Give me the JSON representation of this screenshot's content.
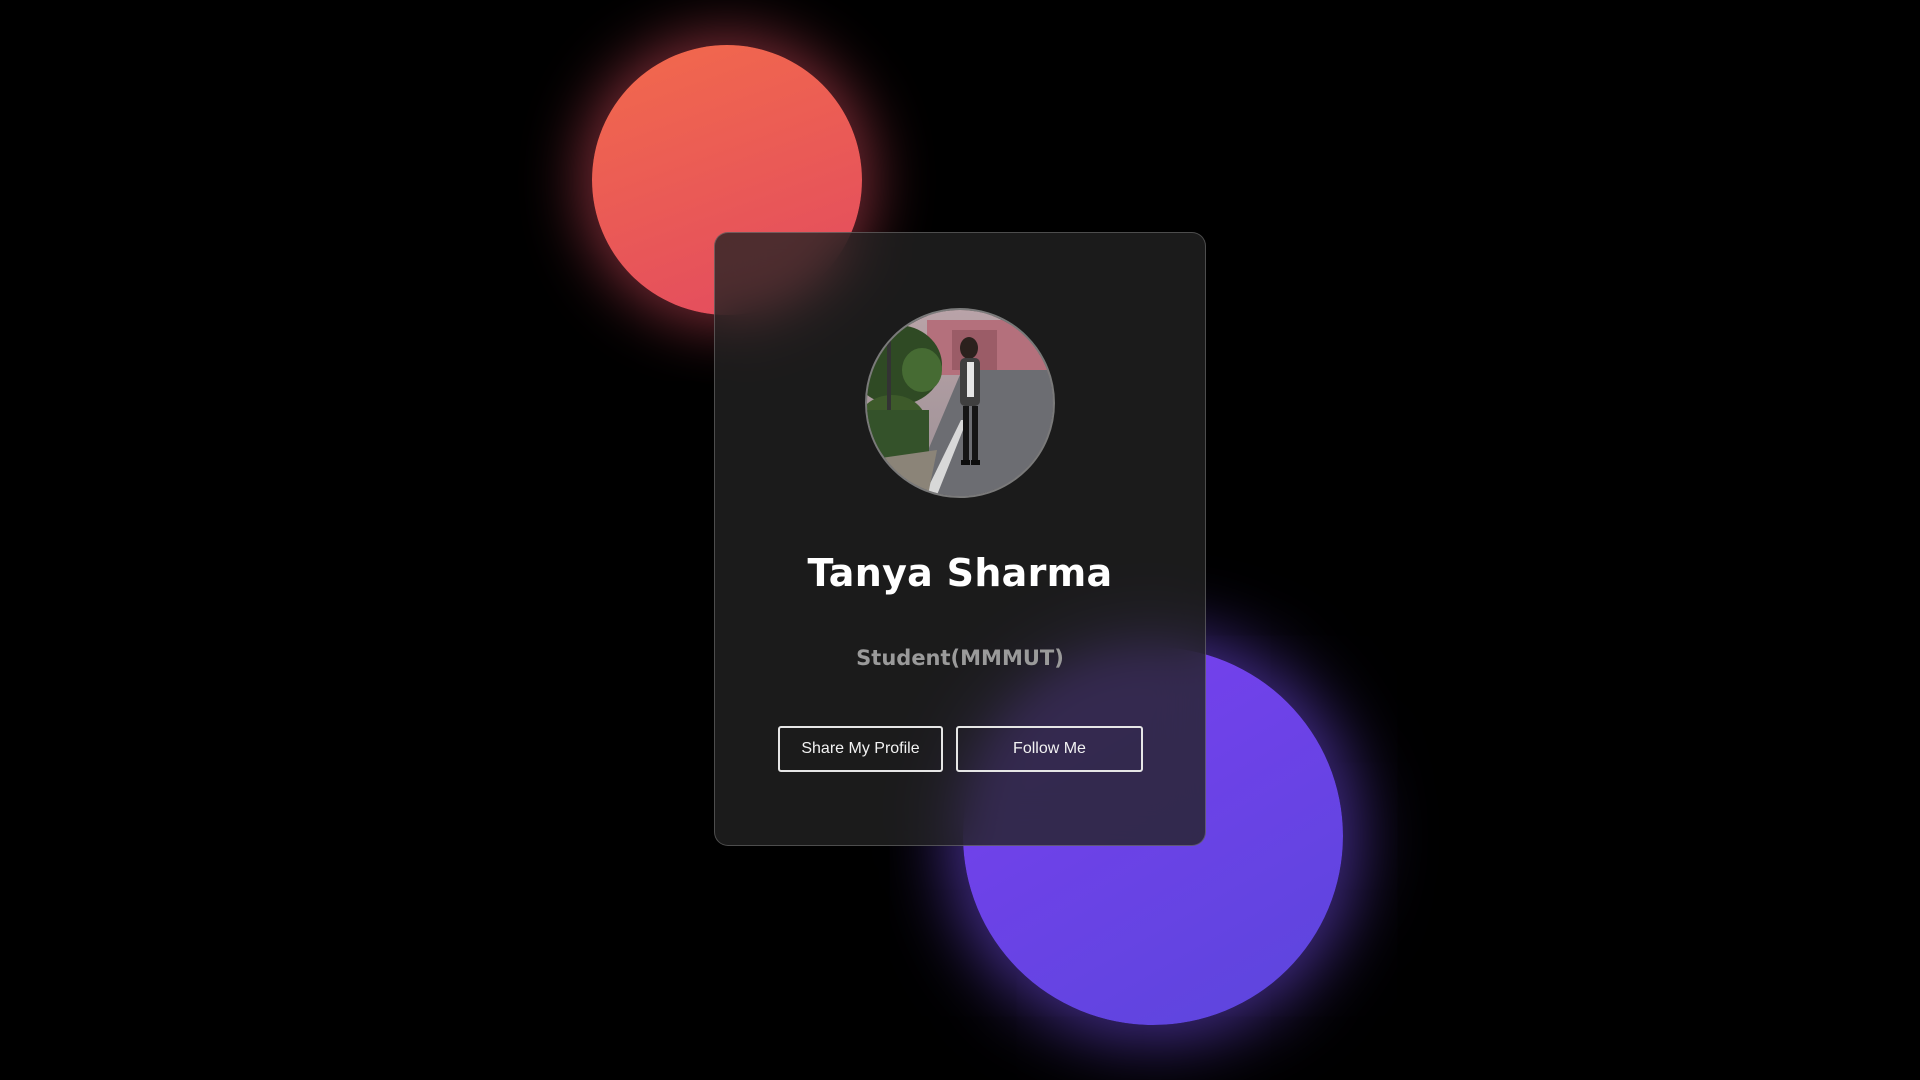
{
  "profile": {
    "name": "Tanya Sharma",
    "role": "Student(MMMUT)",
    "avatar_alt": "profile-photo"
  },
  "actions": {
    "share_label": "Share My Profile",
    "follow_label": "Follow Me"
  },
  "colors": {
    "background": "#000000",
    "orb_red": "#e8505c",
    "orb_purple": "#6a44e8",
    "card": "#1f1f1f",
    "name_text": "#ffffff",
    "role_text": "#9a9a9a"
  }
}
